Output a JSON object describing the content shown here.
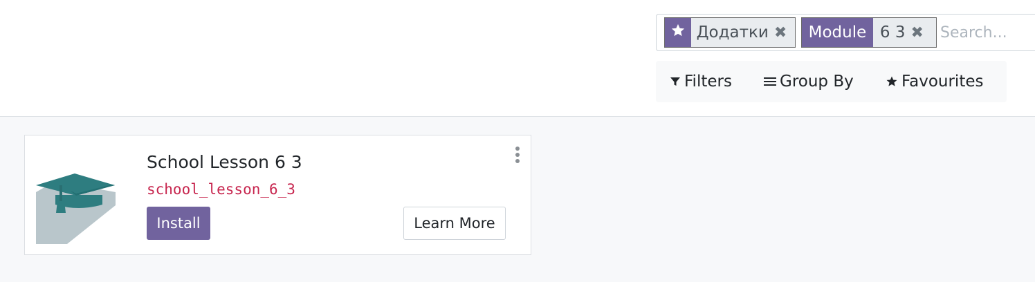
{
  "search": {
    "facets": [
      {
        "icon": "star-icon",
        "values": "Додатки"
      },
      {
        "label": "Module",
        "values": "6 3"
      }
    ],
    "placeholder": "Search..."
  },
  "filter_bar": {
    "filters_label": "Filters",
    "group_by_label": "Group By",
    "favourites_label": "Favourites"
  },
  "module_card": {
    "title": "School Lesson 6 3",
    "technical_name": "school_lesson_6_3",
    "install_label": "Install",
    "learn_more_label": "Learn More",
    "icon": "graduation-cap-icon"
  },
  "colors": {
    "primary": "#71639e",
    "technical_name": "#c7254e",
    "icon_teal": "#2e7d80",
    "icon_shadow": "#b9c6cb"
  }
}
